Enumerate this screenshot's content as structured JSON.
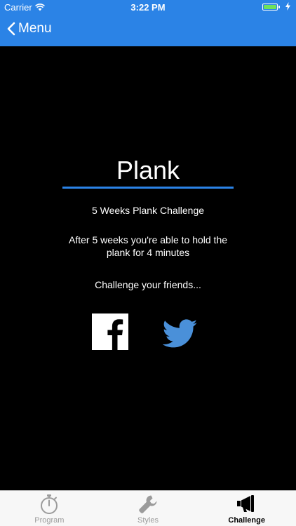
{
  "status_bar": {
    "carrier": "Carrier",
    "time": "3:22 PM",
    "battery_color": "#6ee25b"
  },
  "nav": {
    "back_label": "Menu",
    "back_icon": "chevron-left-icon",
    "bar_color": "#2b83e6"
  },
  "challenge": {
    "title": "Plank",
    "subtitle": "5 Weeks Plank Challenge",
    "description": "After 5 weeks you're able to hold the plank for 4 minutes",
    "cta": "Challenge your friends..."
  },
  "share": {
    "facebook_icon": "facebook-icon",
    "twitter_icon": "twitter-icon",
    "twitter_color": "#4a90d9"
  },
  "tabs": [
    {
      "label": "Program",
      "icon": "stopwatch-icon",
      "active": false
    },
    {
      "label": "Styles",
      "icon": "wrench-icon",
      "active": false
    },
    {
      "label": "Challenge",
      "icon": "megaphone-icon",
      "active": true
    }
  ]
}
